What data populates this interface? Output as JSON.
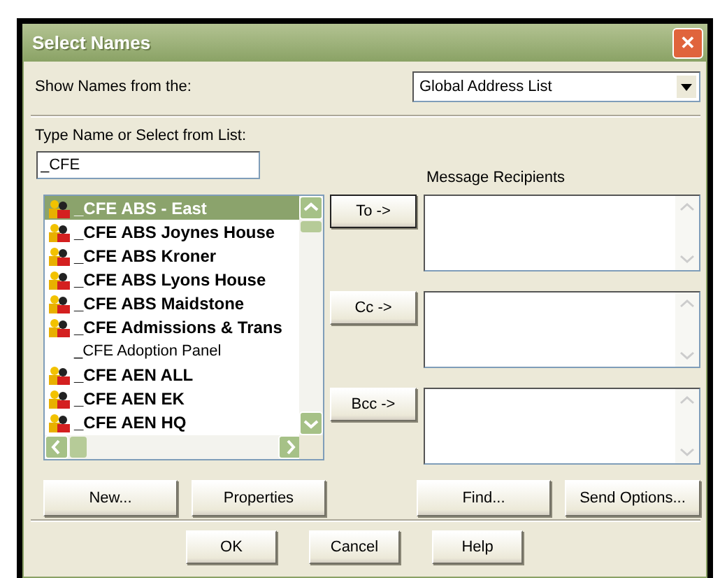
{
  "window": {
    "title": "Select Names",
    "close": "✕"
  },
  "source": {
    "label": "Show Names from the:",
    "value": "Global Address List"
  },
  "search": {
    "label": "Type Name or Select from List:",
    "value": "_CFE"
  },
  "names": [
    {
      "kind": "group",
      "text": "_CFE ABS - East",
      "selected": true
    },
    {
      "kind": "group",
      "text": "_CFE ABS Joynes House",
      "selected": false
    },
    {
      "kind": "group",
      "text": "_CFE ABS Kroner",
      "selected": false
    },
    {
      "kind": "group",
      "text": "_CFE ABS Lyons House",
      "selected": false
    },
    {
      "kind": "group",
      "text": "_CFE ABS Maidstone",
      "selected": false
    },
    {
      "kind": "group",
      "text": "_CFE Admissions & Trans",
      "selected": false
    },
    {
      "kind": "person",
      "text": "_CFE Adoption Panel",
      "selected": false
    },
    {
      "kind": "group",
      "text": "_CFE AEN ALL",
      "selected": false
    },
    {
      "kind": "group",
      "text": "_CFE AEN EK",
      "selected": false
    },
    {
      "kind": "group",
      "text": "_CFE AEN HQ",
      "selected": false
    }
  ],
  "recipients": {
    "label": "Message Recipients",
    "fields": [
      {
        "button": "To ->"
      },
      {
        "button": "Cc ->"
      },
      {
        "button": "Bcc ->"
      }
    ]
  },
  "actions": [
    "New...",
    "Properties",
    "Find...",
    "Send Options..."
  ],
  "buttons": [
    "OK",
    "Cancel",
    "Help"
  ]
}
